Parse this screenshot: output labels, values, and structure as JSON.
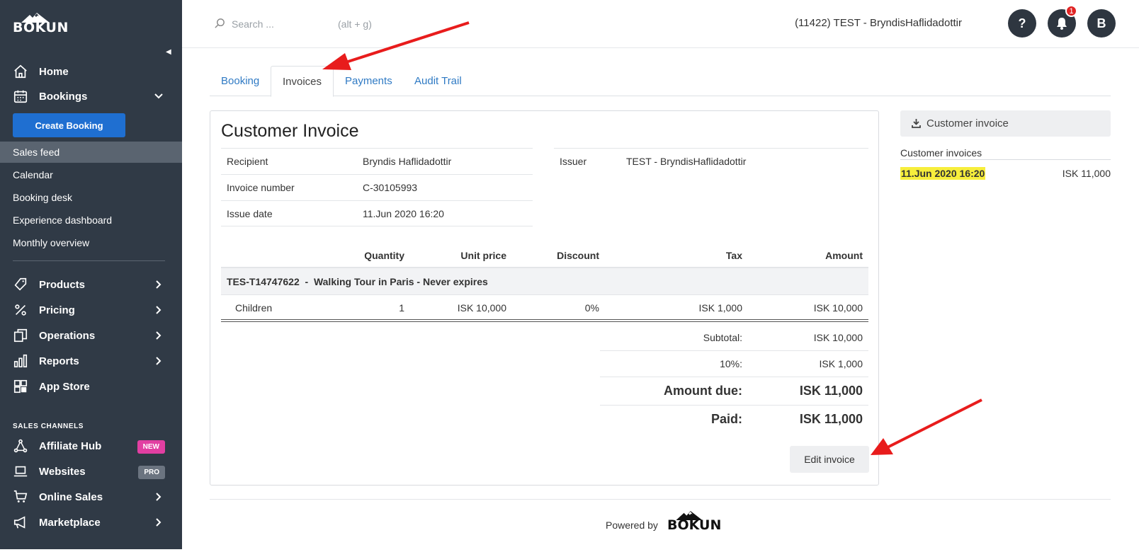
{
  "brand": {
    "logo_text": "BÓKUN",
    "accent": "#1f6fd1",
    "sidebar_bg": "#303a46"
  },
  "sidebar": {
    "home": "Home",
    "bookings": "Bookings",
    "create_booking": "Create Booking",
    "bookings_sub": [
      "Sales feed",
      "Calendar",
      "Booking desk",
      "Experience dashboard",
      "Monthly overview"
    ],
    "products": "Products",
    "pricing": "Pricing",
    "operations": "Operations",
    "reports": "Reports",
    "app_store": "App Store",
    "sales_channels_label": "SALES CHANNELS",
    "affiliate_hub": "Affiliate Hub",
    "affiliate_badge": "NEW",
    "websites": "Websites",
    "websites_badge": "PRO",
    "online_sales": "Online Sales",
    "marketplace": "Marketplace"
  },
  "header": {
    "search_placeholder": "Search ...",
    "search_hint": "(alt + g)",
    "account": "(11422) TEST - BryndisHaflidadottir",
    "help_label": "?",
    "notification_count": "1",
    "avatar_initial": "B"
  },
  "tabs": [
    "Booking",
    "Invoices",
    "Payments",
    "Audit Trail"
  ],
  "invoice": {
    "title": "Customer Invoice",
    "recipient_label": "Recipient",
    "recipient_value": "Bryndis Haflidadottir",
    "number_label": "Invoice number",
    "number_value": "C-30105993",
    "date_label": "Issue date",
    "date_value": "11.Jun 2020 16:20",
    "issuer_label": "Issuer",
    "issuer_value": "TEST - BryndisHaflidadottir",
    "columns": {
      "quantity": "Quantity",
      "unit_price": "Unit price",
      "discount": "Discount",
      "tax": "Tax",
      "amount": "Amount"
    },
    "group_title": "TES-T14747622  -  Walking Tour in Paris - Never expires",
    "line": {
      "name": "Children",
      "quantity": "1",
      "unit_price": "ISK 10,000",
      "discount": "0%",
      "tax": "ISK 1,000",
      "amount": "ISK 10,000"
    },
    "subtotal_label": "Subtotal:",
    "subtotal_value": "ISK 10,000",
    "tax_label": "10%:",
    "tax_value": "ISK 1,000",
    "due_label": "Amount due:",
    "due_value": "ISK 11,000",
    "paid_label": "Paid:",
    "paid_value": "ISK 11,000",
    "edit_button": "Edit invoice"
  },
  "right_panel": {
    "download_label": "Customer invoice",
    "list_title": "Customer invoices",
    "entry_date": "11.Jun 2020 16:20",
    "entry_amount": "ISK 11,000",
    "highlight_color": "#f7ee3c"
  },
  "footer": {
    "powered_by": "Powered by",
    "logo_text": "BÓKUN"
  },
  "annotation_color": "#e81c1c"
}
